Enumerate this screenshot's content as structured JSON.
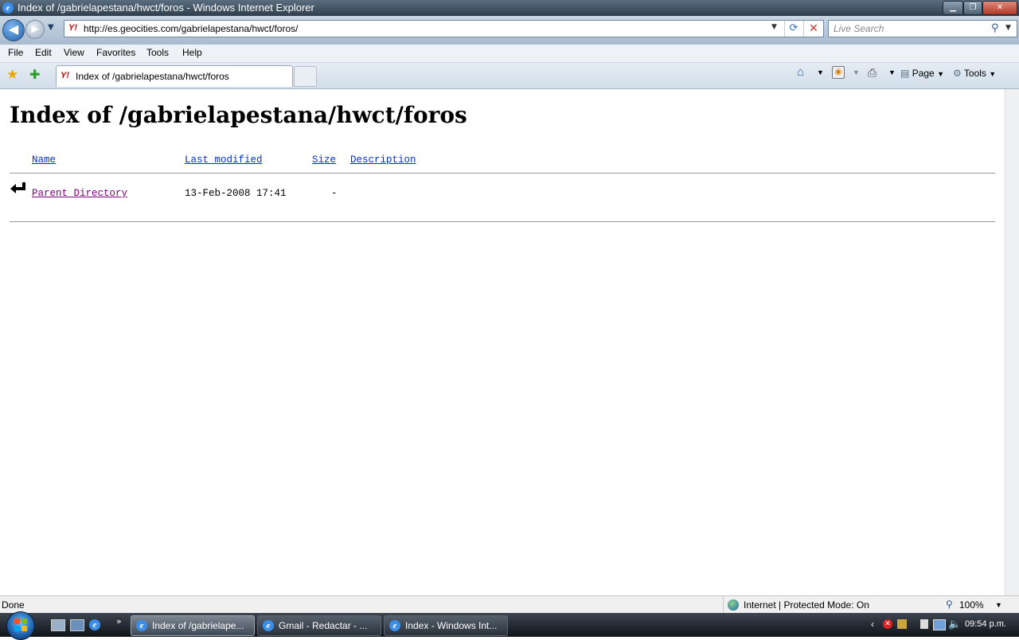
{
  "window": {
    "title": "Index of /gabrielapestana/hwct/foros - Windows Internet Explorer"
  },
  "address_bar": {
    "url": "http://es.geocities.com/gabrielapestana/hwct/foros/"
  },
  "search": {
    "placeholder": "Live Search"
  },
  "menu": [
    "File",
    "Edit",
    "View",
    "Favorites",
    "Tools",
    "Help"
  ],
  "tab": {
    "label": "Index of /gabrielapestana/hwct/foros"
  },
  "command_bar": {
    "page_label": "Page",
    "tools_label": "Tools"
  },
  "page": {
    "heading": "Index of /gabrielapestana/hwct/foros",
    "columns": {
      "name": "Name",
      "last_modified": "Last modified",
      "size": "Size",
      "description": "Description"
    },
    "rows": [
      {
        "name": "Parent Directory",
        "last_modified": "13-Feb-2008 17:41",
        "size": "-",
        "description": ""
      }
    ]
  },
  "status_bar": {
    "status": "Done",
    "zone": "Internet | Protected Mode: On",
    "zoom": "100%"
  },
  "taskbar": {
    "tasks": [
      {
        "label": "Index of /gabrielape...",
        "active": true
      },
      {
        "label": "Gmail - Redactar - ...",
        "active": false
      },
      {
        "label": "Index - Windows Int...",
        "active": false
      }
    ],
    "clock": "09:54 p.m."
  },
  "colors": {
    "link": "#0033cc",
    "visited_link": "#800080",
    "taskbar": "#1a2129"
  },
  "icons": [
    "ie-icon",
    "back-arrow-icon",
    "forward-arrow-icon",
    "yahoo-icon",
    "refresh-icon",
    "stop-icon",
    "search-icon",
    "favorites-star-icon",
    "add-favorites-icon",
    "home-icon",
    "feeds-icon",
    "print-icon",
    "page-icon",
    "tools-gear-icon",
    "parent-directory-icon",
    "globe-icon",
    "zoom-icon",
    "windows-logo-icon"
  ]
}
